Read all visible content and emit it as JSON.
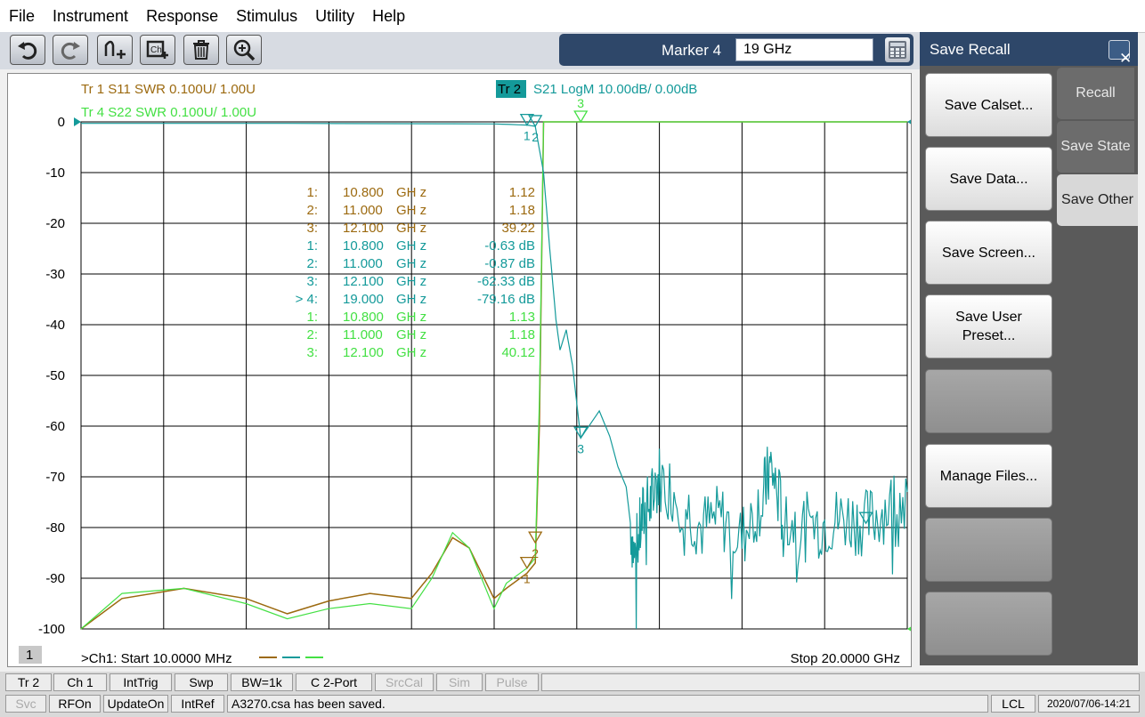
{
  "menu": [
    "File",
    "Instrument",
    "Response",
    "Stimulus",
    "Utility",
    "Help"
  ],
  "toolbar": {
    "buttons": [
      "undo-icon",
      "redo-icon",
      "add-trace-icon",
      "add-channel-icon",
      "delete-icon",
      "zoom-icon"
    ],
    "marker_label": "Marker 4",
    "marker_value": "19 GHz"
  },
  "traces": {
    "tr1": "Tr  1   S11 SWR 0.100U/  1.00U",
    "tr4": "Tr  4   S22 SWR 0.100U/  1.00U",
    "tr2_tag": "Tr  2",
    "tr2": "S21 LogM 10.00dB/  0.00dB"
  },
  "colors": {
    "tr1": "#9c6a10",
    "tr2": "#149a9a",
    "tr4": "#44e044",
    "grid": "#000000"
  },
  "chart_data": {
    "type": "line",
    "x_range_ghz": [
      0.01,
      20
    ],
    "y_ticks": [
      0,
      -10,
      -20,
      -30,
      -40,
      -50,
      -60,
      -70,
      -80,
      -90,
      -100
    ],
    "x_divisions": 10,
    "start_label": ">Ch1:  Start   10.0000 MHz",
    "stop_label": "Stop  20.0000 GHz",
    "channel_number": "1",
    "markers": [
      {
        "n": "1:",
        "f": "10.800",
        "v": "1.12",
        "trace": "tr1"
      },
      {
        "n": "2:",
        "f": "11.000",
        "v": "1.18",
        "trace": "tr1"
      },
      {
        "n": "3:",
        "f": "12.100",
        "v": "39.22",
        "trace": "tr1"
      },
      {
        "n": "1:",
        "f": "10.800",
        "v": "-0.63 dB",
        "trace": "tr2"
      },
      {
        "n": "2:",
        "f": "11.000",
        "v": "-0.87 dB",
        "trace": "tr2"
      },
      {
        "n": "3:",
        "f": "12.100",
        "v": "-62.33 dB",
        "trace": "tr2"
      },
      {
        "n": "> 4:",
        "f": "19.000",
        "v": "-79.16 dB",
        "trace": "tr2"
      },
      {
        "n": "1:",
        "f": "10.800",
        "v": "1.13",
        "trace": "tr4"
      },
      {
        "n": "2:",
        "f": "11.000",
        "v": "1.18",
        "trace": "tr4"
      },
      {
        "n": "3:",
        "f": "12.100",
        "v": "40.12",
        "trace": "tr4"
      }
    ],
    "freq_unit": "GH z",
    "s21_points": [
      [
        0.01,
        -0.3
      ],
      [
        5,
        -0.3
      ],
      [
        10,
        -0.4
      ],
      [
        10.8,
        -0.63
      ],
      [
        11,
        -0.87
      ],
      [
        11.2,
        -10
      ],
      [
        11.35,
        -25
      ],
      [
        11.5,
        -39
      ],
      [
        11.6,
        -45
      ],
      [
        11.75,
        -41
      ],
      [
        11.9,
        -48
      ],
      [
        12.1,
        -62.33
      ],
      [
        12.3,
        -60
      ],
      [
        12.55,
        -57
      ],
      [
        12.8,
        -62
      ],
      [
        13.0,
        -68
      ],
      [
        13.2,
        -72
      ],
      [
        13.4,
        -86
      ],
      [
        13.6,
        -78
      ],
      [
        13.8,
        -75
      ],
      [
        14.0,
        -70
      ],
      [
        14.5,
        -74
      ],
      [
        15,
        -80
      ],
      [
        15.5,
        -78
      ],
      [
        16,
        -82
      ],
      [
        16.5,
        -74
      ],
      [
        16.7,
        -68
      ],
      [
        17,
        -78
      ],
      [
        17.5,
        -80
      ],
      [
        18,
        -79
      ],
      [
        18.5,
        -78
      ],
      [
        19,
        -79.16
      ],
      [
        19.5,
        -76
      ],
      [
        20,
        -73
      ]
    ],
    "s11_points": [
      [
        0.01,
        -100
      ],
      [
        1,
        -94
      ],
      [
        2.5,
        -92
      ],
      [
        4,
        -94
      ],
      [
        5,
        -97
      ],
      [
        6,
        -94.5
      ],
      [
        7,
        -93
      ],
      [
        8,
        -94
      ],
      [
        8.5,
        -89
      ],
      [
        9,
        -82
      ],
      [
        9.4,
        -84
      ],
      [
        10,
        -94
      ],
      [
        10.3,
        -92
      ],
      [
        10.8,
        -89
      ],
      [
        11,
        -87
      ],
      [
        11.1,
        -60
      ],
      [
        11.2,
        0
      ]
    ],
    "s22_points": [
      [
        0.01,
        -100
      ],
      [
        1,
        -93
      ],
      [
        2.5,
        -92
      ],
      [
        4,
        -95
      ],
      [
        5,
        -98
      ],
      [
        6,
        -96
      ],
      [
        7,
        -95
      ],
      [
        8,
        -96
      ],
      [
        8.5,
        -90
      ],
      [
        9,
        -81
      ],
      [
        9.4,
        -84
      ],
      [
        10,
        -96
      ],
      [
        10.3,
        -91
      ],
      [
        10.8,
        -88
      ],
      [
        11,
        -86
      ],
      [
        11.1,
        -55
      ],
      [
        11.2,
        0
      ]
    ]
  },
  "panel": {
    "title": "Save Recall",
    "buttons": [
      "Save Calset...",
      "Save Data...",
      "Save Screen...",
      "Save User Preset...",
      "",
      "Manage Files...",
      "",
      ""
    ],
    "tabs": [
      "Recall",
      "Save State",
      "Save Other"
    ]
  },
  "status1": [
    "Tr 2",
    "Ch 1",
    "IntTrig",
    "Swp",
    "BW=1k",
    "C  2-Port",
    "SrcCal",
    "Sim",
    "Pulse"
  ],
  "status2": [
    "Svc",
    "RFOn",
    "UpdateOn",
    "IntRef",
    "A3270.csa has been saved.",
    "LCL",
    "2020/07/06-14:21"
  ]
}
